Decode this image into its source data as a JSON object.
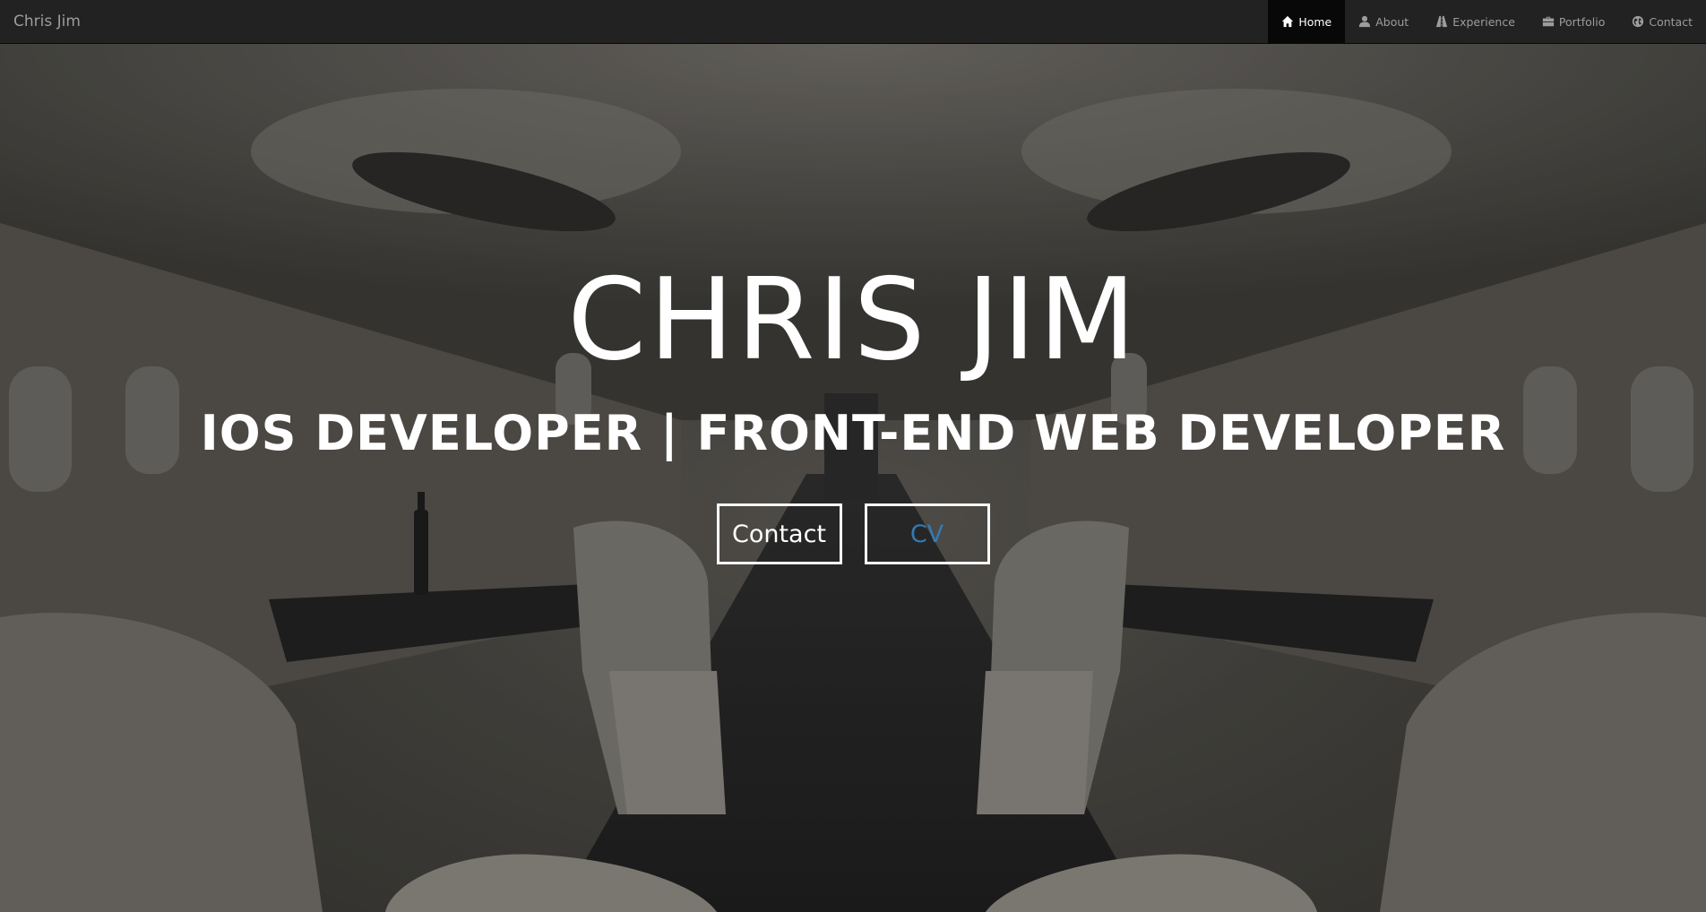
{
  "navbar": {
    "brand": "Chris Jim",
    "items": [
      {
        "label": "Home",
        "icon": "home-icon",
        "active": true
      },
      {
        "label": "About",
        "icon": "user-icon",
        "active": false
      },
      {
        "label": "Experience",
        "icon": "road-icon",
        "active": false
      },
      {
        "label": "Portfolio",
        "icon": "briefcase-icon",
        "active": false
      },
      {
        "label": "Contact",
        "icon": "globe-icon",
        "active": false
      }
    ]
  },
  "hero": {
    "title": "CHRIS JIM",
    "subtitle": "IOS DEVELOPER | FRONT-END WEB DEVELOPER",
    "contact_button": "Contact",
    "cv_button": "CV"
  },
  "colors": {
    "navbar_bg": "#222222",
    "nav_text": "#9d9d9d",
    "nav_active_bg": "#080808",
    "cv_button_text": "#337ab7"
  }
}
